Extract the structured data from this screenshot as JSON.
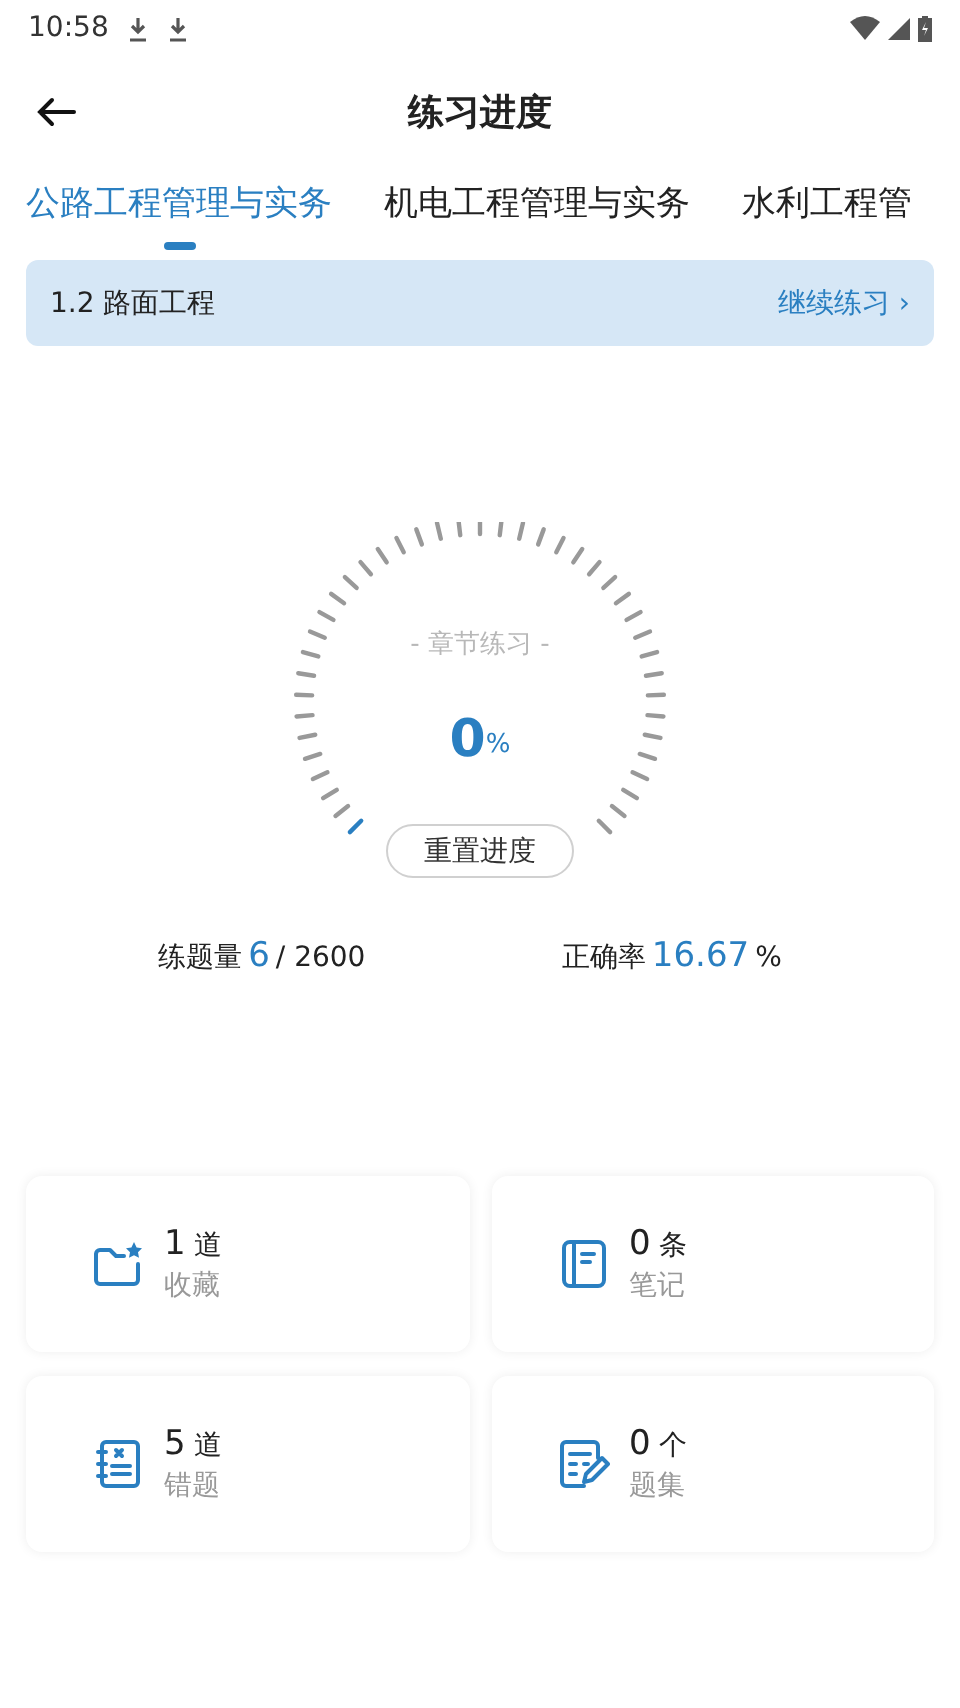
{
  "status_bar": {
    "time": "10:58"
  },
  "header": {
    "title": "练习进度"
  },
  "tabs": [
    {
      "label": "公路工程管理与实务",
      "selected": true
    },
    {
      "label": "机电工程管理与实务",
      "selected": false
    },
    {
      "label": "水利工程管",
      "selected": false
    }
  ],
  "chapter_banner": {
    "chapter": "1.2 路面工程",
    "action": "继续练习",
    "chevron": "›"
  },
  "gauge": {
    "caption": "- 章节练习 -",
    "percent": "0",
    "unit": "%",
    "reset_button": "重置进度"
  },
  "stats": [
    {
      "label": "练题量",
      "value": "6",
      "suffix": "/ 2600"
    },
    {
      "label": "正确率",
      "value": "16.67",
      "suffix": "%"
    }
  ],
  "cards": [
    {
      "kind": "favorites",
      "count": "1",
      "unit": "道",
      "label": "收藏"
    },
    {
      "kind": "notes",
      "count": "0",
      "unit": "条",
      "label": "笔记"
    },
    {
      "kind": "mistakes",
      "count": "5",
      "unit": "道",
      "label": "错题"
    },
    {
      "kind": "sets",
      "count": "0",
      "unit": "个",
      "label": "题集"
    }
  ]
}
